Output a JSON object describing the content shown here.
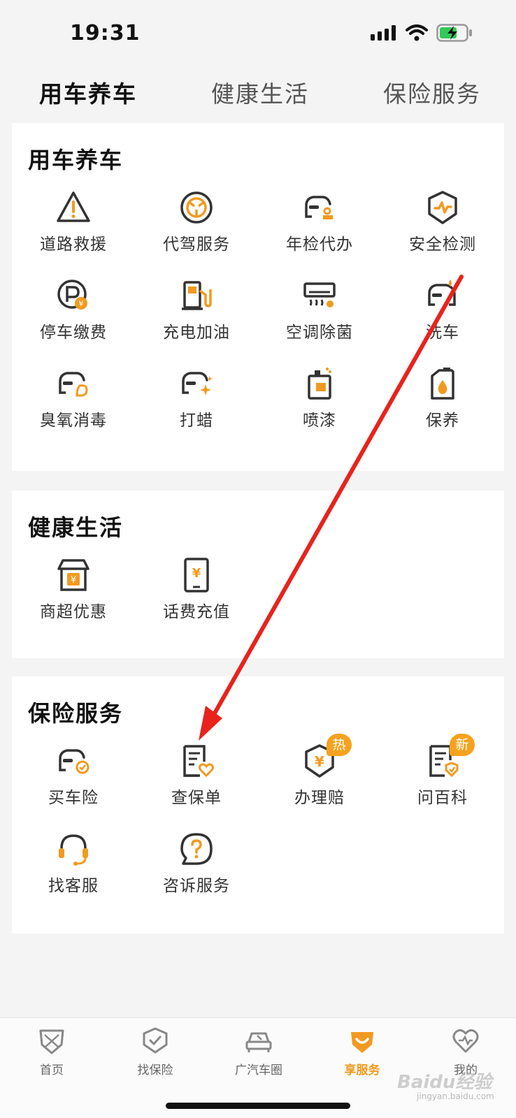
{
  "status_bar": {
    "time": "19:31"
  },
  "top_tabs": [
    {
      "label": "用车养车",
      "active": true
    },
    {
      "label": "健康生活",
      "active": false
    },
    {
      "label": "保险服务",
      "active": false
    }
  ],
  "sections": {
    "car": {
      "title": "用车养车",
      "items": [
        {
          "label": "道路救援",
          "icon": "warning-triangle-icon"
        },
        {
          "label": "代驾服务",
          "icon": "steering-wheel-icon"
        },
        {
          "label": "年检代办",
          "icon": "car-stamp-icon"
        },
        {
          "label": "安全检测",
          "icon": "shield-pulse-icon"
        },
        {
          "label": "停车缴费",
          "icon": "parking-icon"
        },
        {
          "label": "充电加油",
          "icon": "fuel-pump-icon"
        },
        {
          "label": "空调除菌",
          "icon": "air-conditioner-icon"
        },
        {
          "label": "洗车",
          "icon": "car-wash-icon"
        },
        {
          "label": "臭氧消毒",
          "icon": "car-ozone-icon"
        },
        {
          "label": "打蜡",
          "icon": "car-wax-icon"
        },
        {
          "label": "喷漆",
          "icon": "spray-paint-icon"
        },
        {
          "label": "保养",
          "icon": "oil-can-icon"
        }
      ]
    },
    "health": {
      "title": "健康生活",
      "items": [
        {
          "label": "商超优惠",
          "icon": "shop-icon"
        },
        {
          "label": "话费充值",
          "icon": "phone-recharge-icon"
        }
      ]
    },
    "insurance": {
      "title": "保险服务",
      "items": [
        {
          "label": "买车险",
          "icon": "car-insurance-icon",
          "badge": ""
        },
        {
          "label": "查保单",
          "icon": "policy-icon",
          "badge": ""
        },
        {
          "label": "办理赔",
          "icon": "claim-shield-icon",
          "badge": "热"
        },
        {
          "label": "问百科",
          "icon": "encyclopedia-icon",
          "badge": "新"
        },
        {
          "label": "找客服",
          "icon": "headset-icon",
          "badge": ""
        },
        {
          "label": "咨诉服务",
          "icon": "question-bubble-icon",
          "badge": ""
        }
      ]
    }
  },
  "bottom_nav": [
    {
      "label": "首页",
      "icon": "home-badge-icon",
      "active": false
    },
    {
      "label": "找保险",
      "icon": "shield-check-icon",
      "active": false
    },
    {
      "label": "广汽车圈",
      "icon": "car-front-icon",
      "active": false
    },
    {
      "label": "享服务",
      "icon": "service-smile-icon",
      "active": true
    },
    {
      "label": "我的",
      "icon": "heart-icon",
      "active": false
    }
  ],
  "watermark": {
    "main": "Baidu经验",
    "sub": "jingyan.baidu.com"
  },
  "colors": {
    "accent": "#f29a1f",
    "icon_dark": "#333333",
    "arrow": "#e8231c"
  }
}
